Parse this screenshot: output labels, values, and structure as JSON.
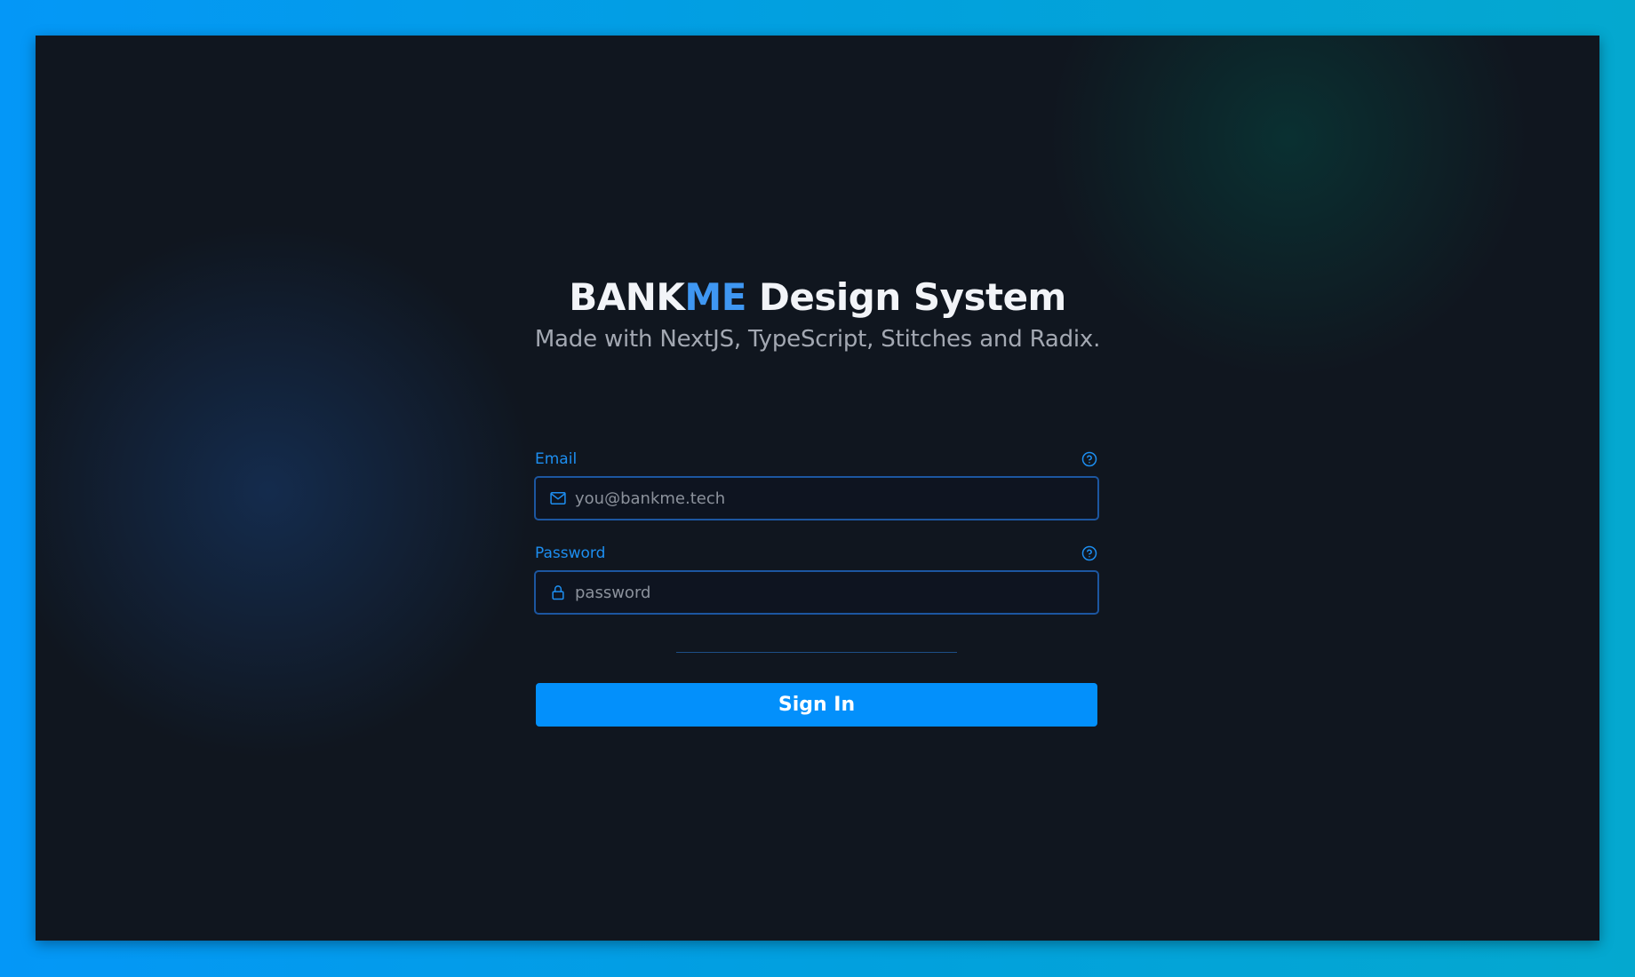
{
  "hero": {
    "title_brand_main": "BANK",
    "title_brand_accent": "ME",
    "title_rest": " Design System",
    "subtitle": "Made with NextJS, TypeScript, Stitches and Radix."
  },
  "form": {
    "email": {
      "label": "Email",
      "placeholder": "you@bankme.tech",
      "value": "",
      "leading_icon": "mail-icon",
      "help_icon": "help-circle-icon"
    },
    "password": {
      "label": "Password",
      "placeholder": "password",
      "value": "",
      "leading_icon": "lock-icon",
      "help_icon": "help-circle-icon"
    },
    "submit_label": "Sign In"
  },
  "theme": {
    "page_background_start": "#0497f7",
    "page_background_end": "#04a8cf",
    "window_background": "#10161f",
    "accent": "#1d8ef0",
    "brand_accent": "#3f97f2",
    "button_background": "#0390fb",
    "input_border": "#1c56a0"
  }
}
